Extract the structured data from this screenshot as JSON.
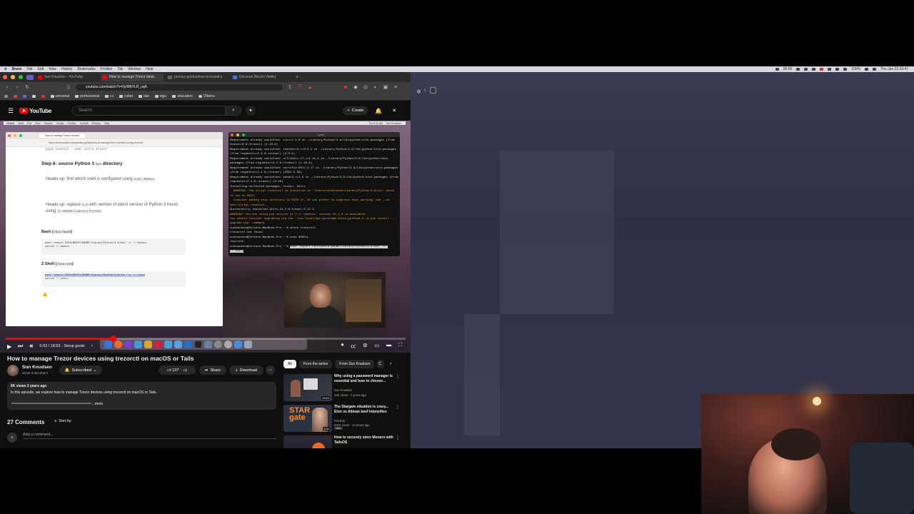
{
  "menubar": {
    "items": [
      "Brave",
      "File",
      "Edit",
      "View",
      "History",
      "Bookmarks",
      "Profiles",
      "Tab",
      "Window",
      "Help"
    ],
    "clock_text": "05:00",
    "date_text": "Thu Jan 23  23:47",
    "battery_text": "100%"
  },
  "browser": {
    "tabs": [
      {
        "label": "Sun Knudsen - YouTube",
        "color": "#ff0000"
      },
      {
        "label": "How to manage Trezor devic",
        "color": "#ff0000"
      },
      {
        "label": "privacy-guides/how-to-install-s",
        "color": "#666666"
      },
      {
        "label": "Electrum Bitcoin Wallet",
        "color": "#3a7bd5"
      }
    ],
    "url": "youtube.com/watch?v=0yWBYLR_uqA",
    "bookmarks": [
      "personal",
      "professional",
      "cv",
      "cyber",
      "law",
      "wgu",
      "education",
      "Ollama"
    ]
  },
  "youtube": {
    "search_placeholder": "Search",
    "create_label": "Create"
  },
  "video": {
    "inner_menubar": [
      "iTerm2",
      "Shell",
      "Edit",
      "View",
      "Session",
      "Scripts",
      "Profiles",
      "Toolbelt",
      "Window",
      "Help"
    ],
    "inner_clock": "Tue 9:11 AM",
    "inner_user": "Sun Knudsen",
    "doc": {
      "tab_label": "How to manage Trezor devices",
      "url": "https://sunknudsen.com/privacy-guides/how-to-manage-trezor-devices-using-trezorctl",
      "top_code": "pip3 install --user attrs trezor",
      "step_heading": "Step 6: source Python 3",
      "step_code": "bin",
      "step_tail": "directory",
      "heads_up_1_pre": "Heads-up: find which shell is configured using",
      "heads_up_1_code": "echo $SHELL",
      "heads_up_2_pre": "Heads-up: replace",
      "heads_up_2_code": "3.8",
      "heads_up_2_mid": "with semver of latest version of Python 3 found using",
      "heads_up_2_code2": "ls $HOME/Library/Python",
      "bash_label": "Bash",
      "bash_path": "/bin/bash",
      "bash_code_1": "echo 'export PATH=$PATH:$HOME/Library/Python/3.8/bin' >> ~/.bashrc",
      "bash_code_2": "source ~/.bashrc",
      "zsh_label": "Z Shell",
      "zsh_path": "/bin/zsh",
      "zsh_code_1": "echo 'export PATH=$PATH:$HOME/Library/Python/3.8/bin' >> ~/.zshrc",
      "zsh_code_2": "source ~/.zshrc",
      "emoji": "👍"
    },
    "terminal": {
      "title": "~ (zsh)",
      "lines": [
        {
          "t": "Requirement already satisfied: six>=1.9.0 in ./Library/Python/3.9/lib/python/site-packages (from ecdsa>=0.9->trezor) (1.16.0)",
          "c": ""
        },
        {
          "t": "Requirement already satisfied: chardet<5,>=3.0.2 in ./Library/Python/3.9/lib/python/site-packages (from requests>=2.4.0->trezor) (4.0.0)",
          "c": ""
        },
        {
          "t": "Requirement already satisfied: urllib3<1.27,>=1.21.1 in ./Library/Python/3.9/lib/python/site-packages (from requests>=2.4.0->trezor) (1.26.6)",
          "c": ""
        },
        {
          "t": "Requirement already satisfied: certifi>=2017.4.17 in ./Library/Python/3.9/lib/python/site-packages (from requests>=2.4.0->trezor) (2021.5.30)",
          "c": ""
        },
        {
          "t": "Requirement already satisfied: idna<3,>=2.5 in ./Library/Python/3.9/lib/python/site-packages (from requests>=2.4.0->trezor) (2.10)",
          "c": ""
        },
        {
          "t": "Installing collected packages: trezor, attrs",
          "c": ""
        },
        {
          "t": "  WARNING: The script trezorctl is installed in '/Users/sunknudsen/Library/Python/3.9/bin' which is not on PATH.",
          "c": "warn"
        },
        {
          "t": "  Consider adding this directory to PATH or, if you prefer to suppress this warning, use --no-warn-script-location.",
          "c": "warn"
        },
        {
          "t": "Successfully installed attrs-21.2.0 trezor-0.12.2",
          "c": ""
        },
        {
          "t": "WARNING: You are using pip version 21.1.1; however, version 21.1.3 is available.",
          "c": "warn"
        },
        {
          "t": "You should consider upgrading via the '/usr/local/opt/python@3.9/bin/python3.9 -m pip install --upgrade pip' command.",
          "c": "warn"
        },
        {
          "t": "sunknudsen@Juliens-MacBook-Pro ~ % which trezorctl",
          "c": ""
        },
        {
          "t": "trezorctl not found",
          "c": ""
        },
        {
          "t": "sunknudsen@Juliens-MacBook-Pro ~ % echo $SHELL",
          "c": ""
        },
        {
          "t": "/bin/zsh",
          "c": ""
        }
      ],
      "last_prompt": "sunknudsen@Juliens-MacBook-Pro ~ % ",
      "last_selected": "echo 'export PATH=$PATH:$HOME/Library/Python/3.8/bin' >> ~/.zshrc"
    },
    "time": "5:03 / 18:53 · Setup guide",
    "progress_fraction": 0.268
  },
  "meta": {
    "title": "How to manage Trezor devices using trezorctl on macOS or Tails",
    "channel": "Sun Knudsen",
    "subscribers": "60.6K subscribers",
    "subscribed_label": "Subscribed",
    "likes": "137",
    "share_label": "Share",
    "download_label": "Download",
    "desc_meta": "6K views  3 years ago",
    "desc_line": "In this episode, we explore how to manage Trezor devices using trezorctl on macOS or Tails.",
    "desc_rule": "==============================================",
    "desc_more": "...more",
    "comments_count": "27 Comments",
    "sort_label": "Sort by",
    "add_comment": "Add a comment..."
  },
  "sidebar": {
    "chips": [
      "All",
      "From the series",
      "From Sun Knudsen",
      "C"
    ],
    "recs": [
      {
        "title": "Why using a password manager is essential and how to choose...",
        "channel": "Sun Knudsen",
        "meta": "34K views · 4 years ago",
        "duration": "15:53"
      },
      {
        "title": "The Stargate situation is crazy... Elon vs Altman beef intensifies",
        "channel": "Fireship",
        "meta": "601K views · 10 hours ago",
        "duration": "3:34",
        "badge": "New"
      },
      {
        "title": "How to securely store Monero with TailsOS",
        "channel": "",
        "meta": "",
        "duration": ""
      }
    ]
  }
}
